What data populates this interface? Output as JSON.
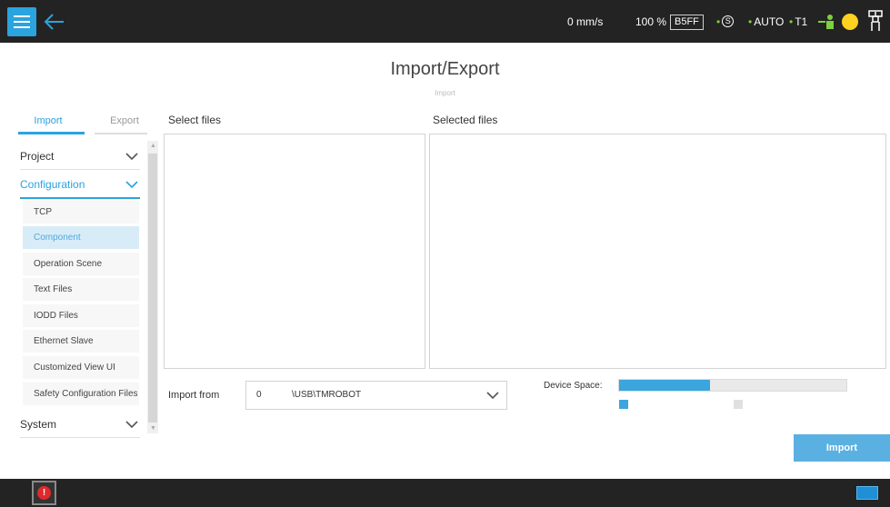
{
  "header": {
    "speed": "0 mm/s",
    "speed_percent": "100 %",
    "code": "B5FF",
    "mode_s": "S",
    "mode_auto": "AUTO",
    "mode_t1": "T1",
    "dot": "•",
    "status_color": "#ffd21f",
    "accent_color": "#2aa3df"
  },
  "page": {
    "title": "Import/Export",
    "subtitle": "Import"
  },
  "tabs": {
    "import": "Import",
    "export": "Export"
  },
  "nav": {
    "project": "Project",
    "configuration": "Configuration",
    "system": "System",
    "items": [
      "TCP",
      "Component",
      "Operation Scene",
      "Text Files",
      "IODD Files",
      "Ethernet Slave",
      "Customized View UI",
      "Safety Configuration Files"
    ],
    "selected_item": "Component"
  },
  "panels": {
    "select_files": "Select files",
    "selected_files": "Selected files"
  },
  "import_from": {
    "label": "Import from",
    "index": "0",
    "path": "\\USB\\TMROBOT"
  },
  "device_space": {
    "label": "Device Space:",
    "used_fraction": 0.4
  },
  "actions": {
    "import_button": "Import"
  },
  "icons": {
    "menu": "menu-icon",
    "back": "back-arrow-icon",
    "robot": "robot-status-icon",
    "tool": "tool-icon",
    "alert": "alert-icon",
    "keyboard": "keyboard-icon"
  }
}
